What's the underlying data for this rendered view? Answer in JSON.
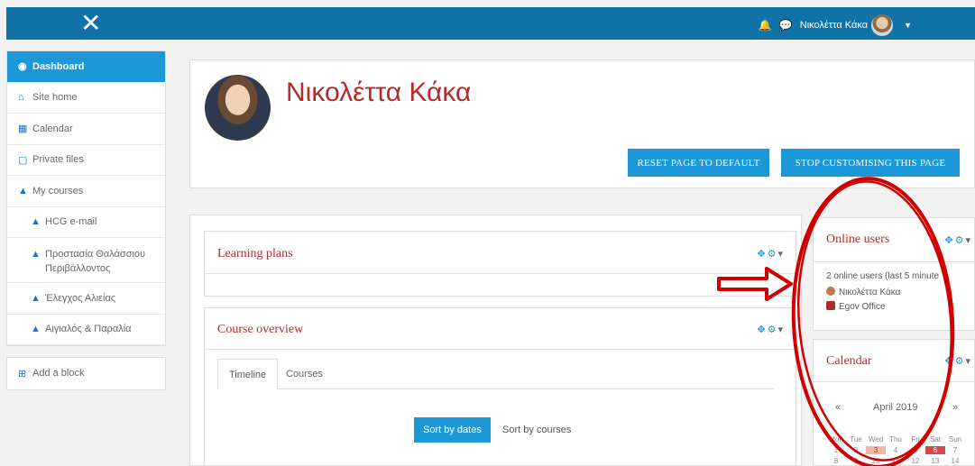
{
  "topbar": {
    "close_glyph": "✕",
    "user_name": "Νικολέττα Κάκα",
    "icons": [
      "bell-icon",
      "chat-icon",
      "avatar",
      "caret-down-icon"
    ],
    "color": "#0f73a8"
  },
  "sidebar": {
    "items": [
      {
        "label": "Dashboard",
        "icon": "dashboard-icon",
        "active": true
      },
      {
        "label": "Site home",
        "icon": "home-icon"
      },
      {
        "label": "Calendar",
        "icon": "calendar-icon"
      },
      {
        "label": "Private files",
        "icon": "file-icon"
      },
      {
        "label": "My courses",
        "icon": "graduation-cap-icon"
      },
      {
        "label": "HCG e-mail",
        "icon": "graduation-cap-icon"
      },
      {
        "label": "Προστασία Θαλάσσιου Περιβάλλοντος",
        "icon": "graduation-cap-icon"
      },
      {
        "label": "Έλεγχος Αλιείας",
        "icon": "graduation-cap-icon"
      },
      {
        "label": "Αιγιαλός & Παραλία",
        "icon": "graduation-cap-icon"
      }
    ],
    "add_block": "Add a block"
  },
  "header": {
    "name": "Νικολέττα Κάκα",
    "reset_label": "RESET PAGE TO DEFAULT",
    "stop_label": "STOP CUSTOMISING THIS PAGE"
  },
  "blocks": {
    "learning_plans": {
      "title": "Learning plans"
    },
    "course_overview": {
      "title": "Course overview",
      "tabs": [
        "Timeline",
        "Courses"
      ],
      "sort_dates": "Sort by dates",
      "sort_courses": "Sort by courses"
    }
  },
  "online_users": {
    "title": "Online users",
    "summary": "2 online users (last 5 minute",
    "users": [
      "Νικολέττα Κάκα",
      "Egov Office"
    ]
  },
  "calendar": {
    "title": "Calendar",
    "prev": "«",
    "month": "April 2019",
    "next": "»",
    "weekdays": [
      "Mon",
      "Tue",
      "Wed",
      "Thu",
      "Fri",
      "Sat",
      "Sun"
    ],
    "week1": [
      "1",
      "2",
      "3",
      "4",
      "5",
      "6",
      "7"
    ],
    "week2": [
      "8",
      "9",
      "10",
      "11",
      "12",
      "13",
      "14"
    ]
  },
  "colors": {
    "accent": "#1c98d8",
    "title_red": "#b52a2a",
    "annotation_red": "#d10000"
  }
}
